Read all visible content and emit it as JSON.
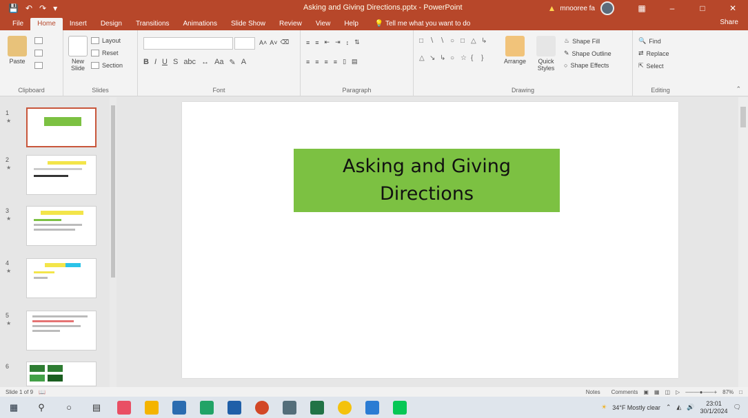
{
  "app": {
    "window_title": "Asking and Giving Directions.pptx  -  PowerPoint",
    "user_label": "mnooree fa",
    "colors": {
      "accent": "#b7472a",
      "slide_title_bg": "#7cc142"
    }
  },
  "quick_access": {
    "save_icon": "save-icon",
    "undo_icon": "undo-icon",
    "redo_icon": "redo-icon"
  },
  "tabs": [
    {
      "label": "File"
    },
    {
      "label": "Home"
    },
    {
      "label": "Insert"
    },
    {
      "label": "Design"
    },
    {
      "label": "Transitions"
    },
    {
      "label": "Animations"
    },
    {
      "label": "Slide Show"
    },
    {
      "label": "Review"
    },
    {
      "label": "View"
    },
    {
      "label": "Help"
    }
  ],
  "tell_me": "Tell me what you want to do",
  "share_label": "Share",
  "ribbon": {
    "clipboard": {
      "label": "Clipboard",
      "paste": "Paste"
    },
    "slides": {
      "label": "Slides",
      "new_slide": "New Slide",
      "layout": "Layout",
      "reset": "Reset",
      "section": "Section"
    },
    "font": {
      "label": "Font"
    },
    "paragraph": {
      "label": "Paragraph"
    },
    "drawing": {
      "label": "Drawing",
      "arrange": "Arrange",
      "quick_styles": "Quick Styles",
      "shape_fill": "Shape Fill",
      "shape_outline": "Shape Outline",
      "shape_effects": "Shape Effects"
    },
    "editing": {
      "label": "Editing",
      "find": "Find",
      "replace": "Replace",
      "select": "Select"
    }
  },
  "slides_panel": {
    "numbers": [
      "1",
      "2",
      "3",
      "4",
      "5",
      "6"
    ]
  },
  "slide": {
    "title_line1": "Asking and Giving",
    "title_line2": "Directions"
  },
  "status": {
    "slide_info": "Slide 1 of 9",
    "notes": "Notes",
    "comments": "Comments",
    "zoom": "87%"
  },
  "taskbar": {
    "weather": "34°F  Mostly clear",
    "time": "23:01",
    "date": "30/1/2024"
  }
}
